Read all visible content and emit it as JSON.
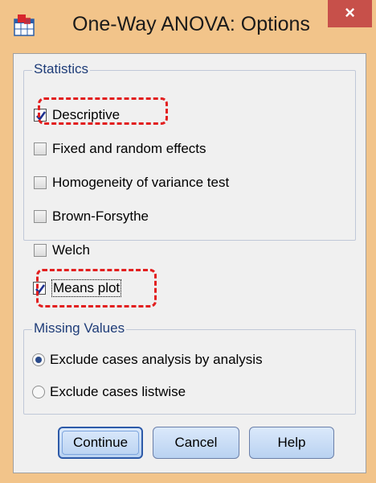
{
  "window": {
    "title": "One-Way ANOVA: Options",
    "close": "×"
  },
  "statistics": {
    "legend": "Statistics",
    "items": [
      {
        "label": "Descriptive",
        "checked": true
      },
      {
        "label": "Fixed and random effects",
        "checked": false
      },
      {
        "label": "Homogeneity of variance test",
        "checked": false
      },
      {
        "label": "Brown-Forsythe",
        "checked": false
      },
      {
        "label": "Welch",
        "checked": false
      }
    ]
  },
  "means_plot": {
    "label": "Means plot",
    "checked": true
  },
  "missing_values": {
    "legend": "Missing Values",
    "options": [
      {
        "label": "Exclude cases analysis by analysis",
        "selected": true
      },
      {
        "label": "Exclude cases listwise",
        "selected": false
      }
    ]
  },
  "buttons": {
    "continue": "Continue",
    "cancel": "Cancel",
    "help": "Help"
  },
  "colors": {
    "frame": "#f2c48a",
    "close": "#c7504a",
    "highlight": "#e21f1f"
  }
}
